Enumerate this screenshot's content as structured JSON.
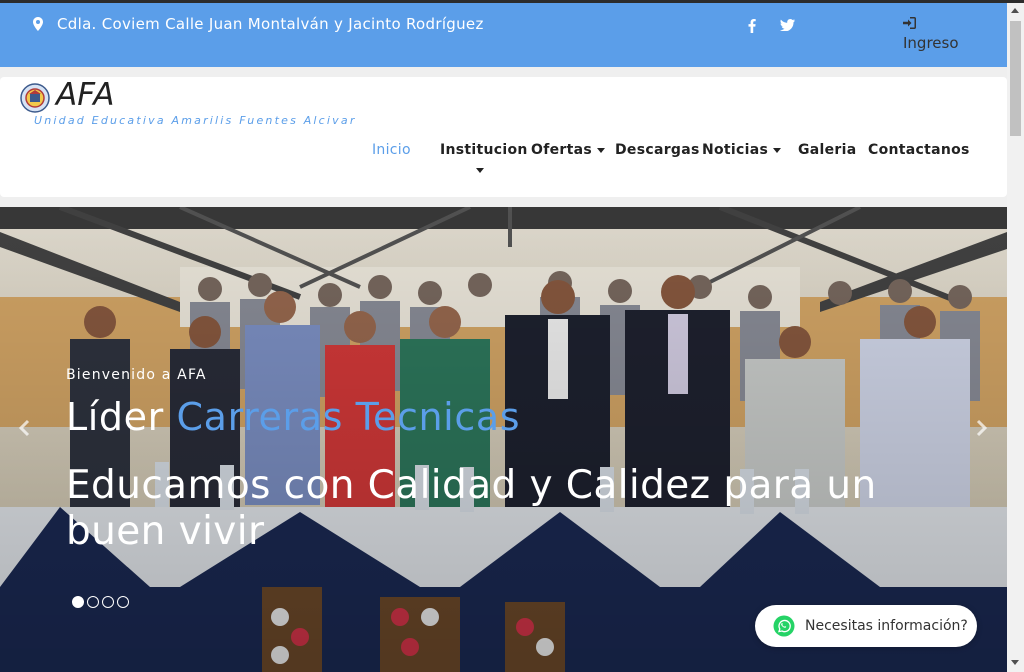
{
  "topbar": {
    "address": "Cdla. Coviem Calle Juan Montalván y Jacinto Rodríguez",
    "address_icon": "map-marker-icon",
    "social_icons": [
      "facebook-icon",
      "twitter-icon"
    ],
    "login_icon": "sign-in-icon",
    "login_label": "Ingreso"
  },
  "brand": {
    "name": "AFA",
    "tagline": "Unidad Educativa Amarilis Fuentes Alcivar"
  },
  "nav": {
    "items": [
      {
        "label": "Inicio",
        "active": true
      },
      {
        "label": "Institucion",
        "dropdown": true
      },
      {
        "label": "Ofertas",
        "dropdown": true
      },
      {
        "label": "Descargas"
      },
      {
        "label": "Noticias",
        "dropdown": true
      },
      {
        "label": "Galeria"
      },
      {
        "label": "Contactanos"
      }
    ]
  },
  "hero": {
    "kicker": "Bienvenido a AFA",
    "title_prefix": "Líder",
    "title_accent": "Carreras Tecnicas",
    "subtitle": "Educamos con Calidad y Calidez para un buen vivir",
    "slide_count": 4,
    "active_slide": 1
  },
  "whatsapp": {
    "icon": "whatsapp-icon",
    "label": "Necesitas información?"
  },
  "colors": {
    "accent": "#5b9ee9",
    "topbar": "#5b9ee9",
    "whatsapp": "#25d366"
  }
}
